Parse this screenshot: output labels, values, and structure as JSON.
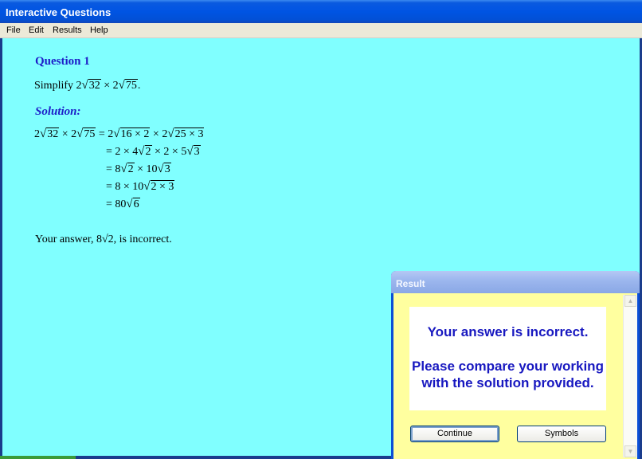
{
  "window": {
    "title": "Interactive Questions"
  },
  "menu": {
    "file": "File",
    "edit": "Edit",
    "results": "Results",
    "help": "Help"
  },
  "question": {
    "heading": "Question 1",
    "prompt_prefix": "Simplify ",
    "prompt_suffix": "."
  },
  "solution": {
    "heading": "Solution:"
  },
  "feedback": {
    "prefix": "Your answer, ",
    "answer": "8√2",
    "suffix": ", is incorrect."
  },
  "dialog": {
    "title": "Result",
    "line1": "Your answer is incorrect.",
    "line2": "Please compare your working with the solution provided.",
    "continue_label": "Continue",
    "symbols_label": "Symbols"
  },
  "icons": {
    "scroll_up": "scroll-up-arrow",
    "scroll_down": "scroll-down-arrow"
  },
  "colors": {
    "background": "#80ffff",
    "heading": "#1d1dc8",
    "dialog_body": "#ffff9f",
    "dialog_text": "#1818c0"
  }
}
